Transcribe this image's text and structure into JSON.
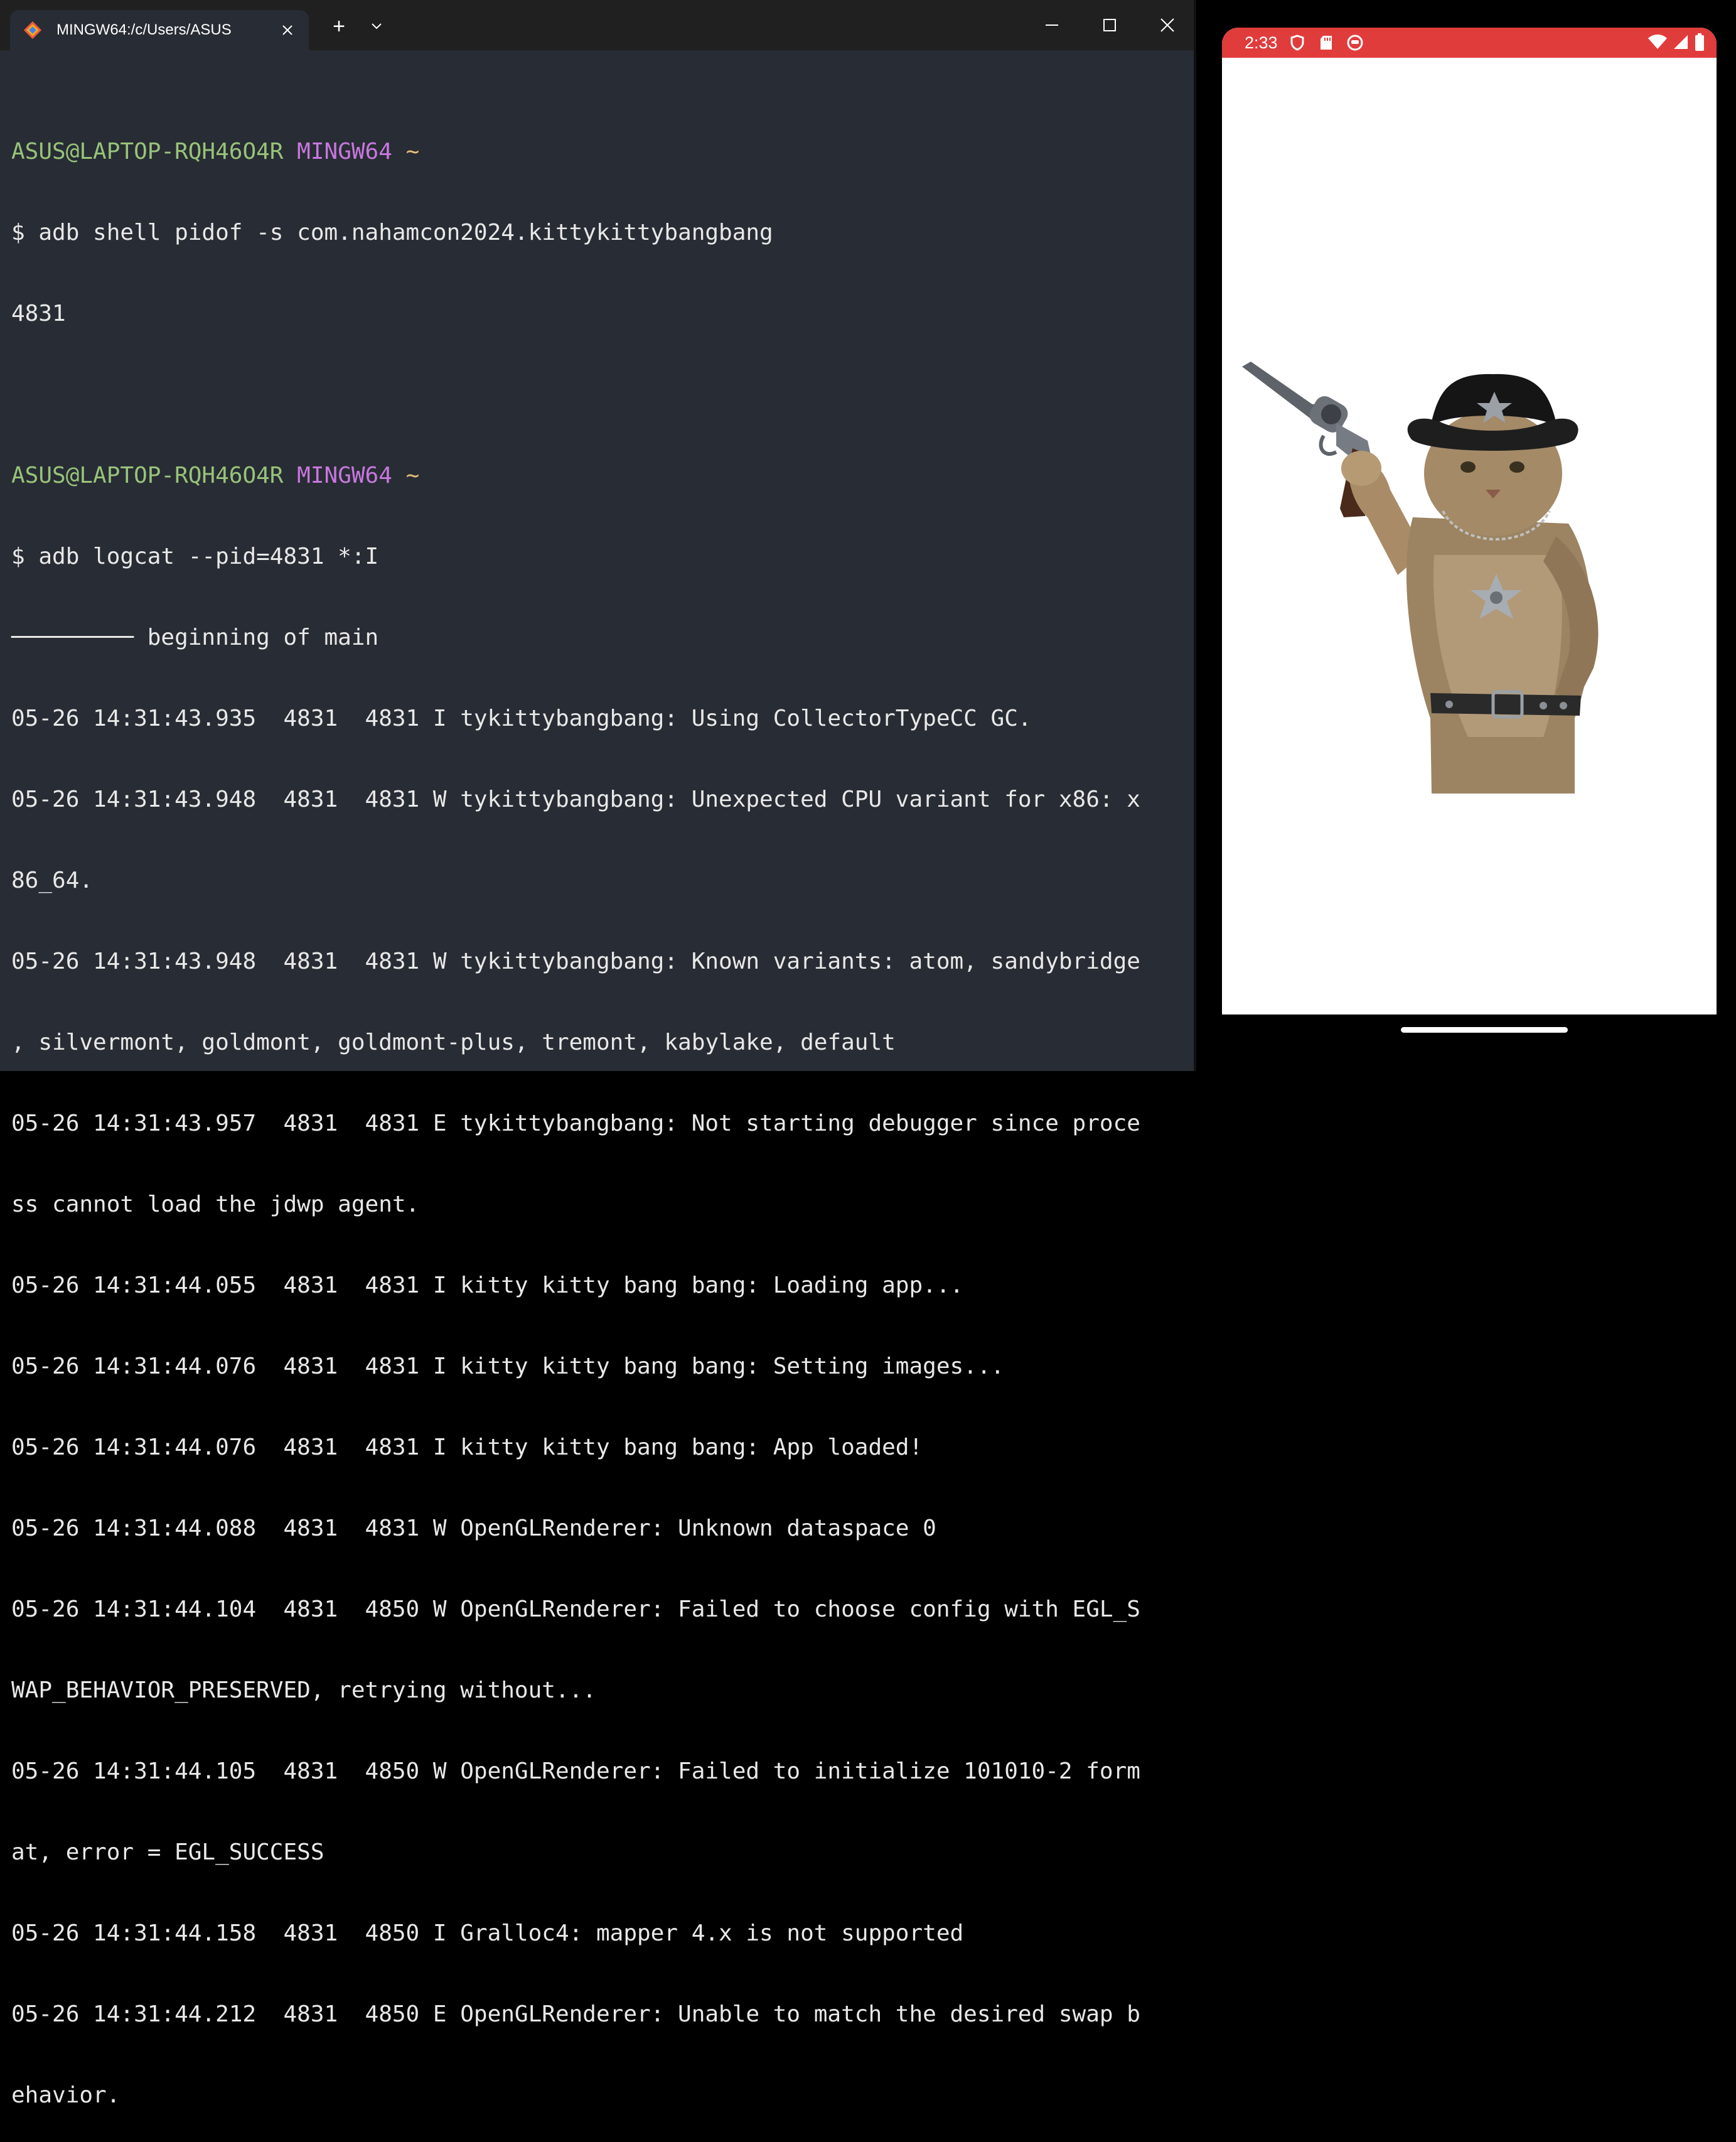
{
  "window": {
    "tab_title": "MINGW64:/c/Users/ASUS",
    "new_tab_label": "+",
    "colors": {
      "background": "#282c34",
      "titlebar": "#202020",
      "user": "#98c379",
      "host": "#c678dd",
      "path": "#e5c07b",
      "text": "#e8e8e8"
    }
  },
  "terminal": {
    "blank_top": "",
    "prompt1": {
      "user_host": "ASUS@LAPTOP-RQH46O4R",
      "shell": "MINGW64",
      "path": "~"
    },
    "cmd1": "$ adb shell pidof -s com.nahamcon2024.kittykittybangbang",
    "out1": "4831",
    "blank": "",
    "prompt2": {
      "user_host": "ASUS@LAPTOP-RQH46O4R",
      "shell": "MINGW64",
      "path": "~"
    },
    "cmd2": "$ adb logcat --pid=4831 *:I",
    "log_lines": [
      "───────── beginning of main",
      "05-26 14:31:43.935  4831  4831 I tykittybangbang: Using CollectorTypeCC GC.",
      "05-26 14:31:43.948  4831  4831 W tykittybangbang: Unexpected CPU variant for x86: x",
      "86_64.",
      "05-26 14:31:43.948  4831  4831 W tykittybangbang: Known variants: atom, sandybridge",
      ", silvermont, goldmont, goldmont-plus, tremont, kabylake, default",
      "05-26 14:31:43.957  4831  4831 E tykittybangbang: Not starting debugger since proce",
      "ss cannot load the jdwp agent.",
      "05-26 14:31:44.055  4831  4831 I kitty kitty bang bang: Loading app...",
      "05-26 14:31:44.076  4831  4831 I kitty kitty bang bang: Setting images...",
      "05-26 14:31:44.076  4831  4831 I kitty kitty bang bang: App loaded!",
      "05-26 14:31:44.088  4831  4831 W OpenGLRenderer: Unknown dataspace 0",
      "05-26 14:31:44.104  4831  4850 W OpenGLRenderer: Failed to choose config with EGL_S",
      "WAP_BEHAVIOR_PRESERVED, retrying without...",
      "05-26 14:31:44.105  4831  4850 W OpenGLRenderer: Failed to initialize 101010-2 form",
      "at, error = EGL_SUCCESS",
      "05-26 14:31:44.158  4831  4850 I Gralloc4: mapper 4.x is not supported",
      "05-26 14:31:44.212  4831  4850 E OpenGLRenderer: Unable to match the desired swap b",
      "ehavior."
    ]
  },
  "phone": {
    "time": "2:33",
    "statusbar_color": "#e03c3c",
    "status_icons": [
      "vpn-shield-icon",
      "sd-card-icon",
      "app-notification-icon"
    ],
    "right_icons": [
      "wifi-icon",
      "cell-signal-icon",
      "battery-icon"
    ],
    "image_subject": "cat-cowboy-with-revolver"
  }
}
